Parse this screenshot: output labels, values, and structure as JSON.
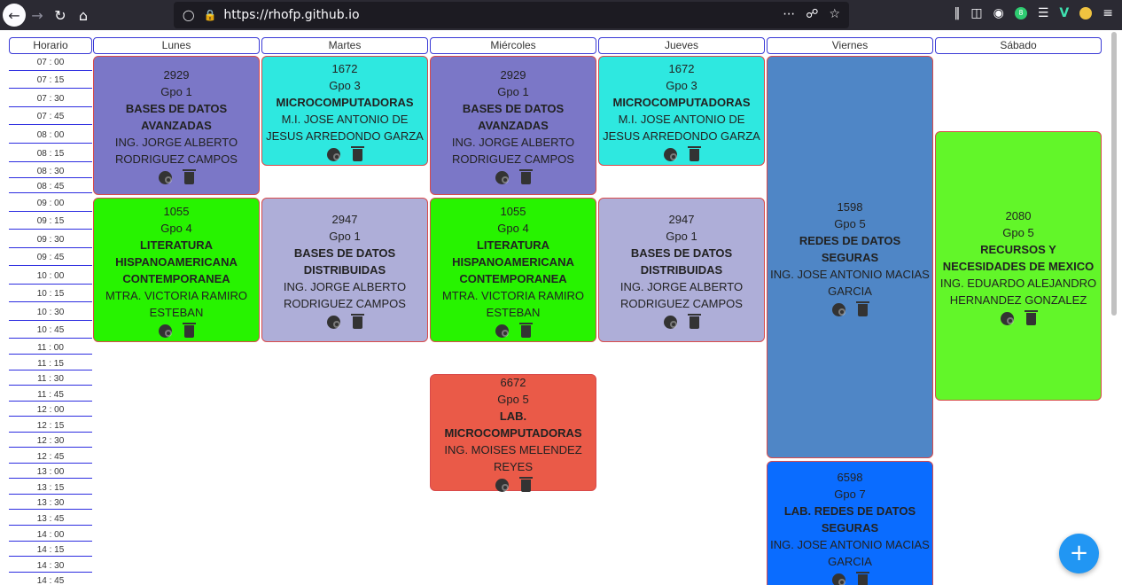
{
  "browser": {
    "url": "https://rhofp.github.io",
    "back_icon": "arrow-left-icon",
    "forward_icon": "arrow-right-icon",
    "reload_icon": "reload-icon",
    "home_icon": "home-icon"
  },
  "headers": {
    "time": "Horario",
    "days": [
      "Lunes",
      "Martes",
      "Miércoles",
      "Jueves",
      "Viernes",
      "Sábado"
    ]
  },
  "times": [
    "07 : 00",
    "07 : 15",
    "07 : 30",
    "07 : 45",
    "08 : 00",
    "08 : 15",
    "08 : 30",
    "08 : 45",
    "09 : 00",
    "09 : 15",
    "09 : 30",
    "09 : 45",
    "10 : 00",
    "10 : 15",
    "10 : 30",
    "10 : 45",
    "11 : 00",
    "11 : 15",
    "11 : 30",
    "11 : 45",
    "12 : 00",
    "12 : 15",
    "12 : 30",
    "12 : 45",
    "13 : 00",
    "13 : 15",
    "13 : 30",
    "13 : 45",
    "14 : 00",
    "14 : 15",
    "14 : 30",
    "14 : 45"
  ],
  "classes": [
    {
      "code": "2929",
      "group": "Gpo 1",
      "name": "BASES DE DATOS AVANZADAS",
      "teacher": "ING. JORGE ALBERTO RODRIGUEZ CAMPOS",
      "color": "#7b77c7",
      "day": "Lunes"
    },
    {
      "code": "1672",
      "group": "Gpo 3",
      "name": "MICROCOMPUTADORAS",
      "teacher": "M.I. JOSE ANTONIO DE JESUS ARREDONDO GARZA",
      "color": "#2ee8e0",
      "day": "Martes"
    },
    {
      "code": "2929",
      "group": "Gpo 1",
      "name": "BASES DE DATOS AVANZADAS",
      "teacher": "ING. JORGE ALBERTO RODRIGUEZ CAMPOS",
      "color": "#7b77c7",
      "day": "Miércoles"
    },
    {
      "code": "1672",
      "group": "Gpo 3",
      "name": "MICROCOMPUTADORAS",
      "teacher": "M.I. JOSE ANTONIO DE JESUS ARREDONDO GARZA",
      "color": "#2ee8e0",
      "day": "Jueves"
    },
    {
      "code": "1598",
      "group": "Gpo 5",
      "name": "REDES DE DATOS SEGURAS",
      "teacher": "ING. JOSE ANTONIO MACIAS GARCIA",
      "color": "#4f86c6",
      "day": "Viernes"
    },
    {
      "code": "2080",
      "group": "Gpo 5",
      "name": "RECURSOS Y NECESIDADES DE MEXICO",
      "teacher": "ING. EDUARDO ALEJANDRO HERNANDEZ GONZALEZ",
      "color": "#62f629",
      "day": "Sábado"
    },
    {
      "code": "1055",
      "group": "Gpo 4",
      "name": "LITERATURA HISPANOAMERICANA CONTEMPORANEA",
      "teacher": "MTRA. VICTORIA RAMIRO ESTEBAN",
      "color": "#27f300",
      "day": "Lunes"
    },
    {
      "code": "2947",
      "group": "Gpo 1",
      "name": "BASES DE DATOS DISTRIBUIDAS",
      "teacher": "ING. JORGE ALBERTO RODRIGUEZ CAMPOS",
      "color": "#aeaed8",
      "day": "Martes"
    },
    {
      "code": "1055",
      "group": "Gpo 4",
      "name": "LITERATURA HISPANOAMERICANA CONTEMPORANEA",
      "teacher": "MTRA. VICTORIA RAMIRO ESTEBAN",
      "color": "#27f300",
      "day": "Miércoles"
    },
    {
      "code": "2947",
      "group": "Gpo 1",
      "name": "BASES DE DATOS DISTRIBUIDAS",
      "teacher": "ING. JORGE ALBERTO RODRIGUEZ CAMPOS",
      "color": "#aeaed8",
      "day": "Jueves"
    },
    {
      "code": "6672",
      "group": "Gpo 5",
      "name": "LAB. MICROCOMPUTADORAS",
      "teacher": "ING. MOISES MELENDEZ REYES",
      "color": "#ea5a48",
      "day": "Miércoles"
    },
    {
      "code": "6598",
      "group": "Gpo 7",
      "name": "LAB. REDES DE DATOS SEGURAS",
      "teacher": "ING. JOSE ANTONIO MACIAS GARCIA",
      "color": "#0a6cff",
      "day": "Viernes"
    }
  ],
  "fab_label": "+",
  "icons": {
    "palette": "palette-icon",
    "trash": "trash-icon"
  }
}
